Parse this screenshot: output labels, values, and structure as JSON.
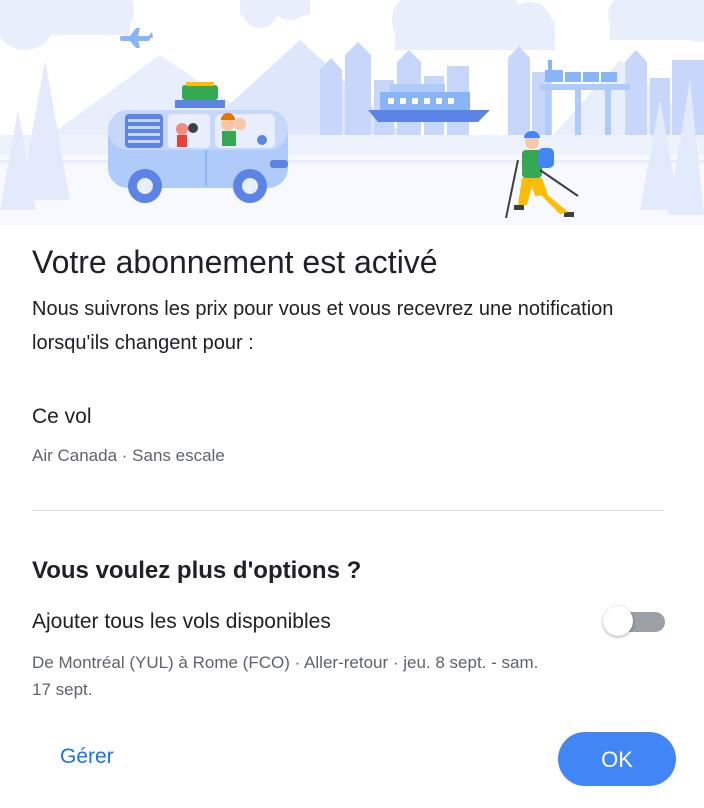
{
  "dialog": {
    "title": "Votre abonnement est activé",
    "description": "Nous suivrons les prix pour vous et vous recevrez une notification lorsqu'ils changent pour :",
    "item": {
      "title": "Ce vol",
      "subtitle": "Air Canada · Sans escale"
    },
    "more_options": {
      "title": "Vous voulez plus d'options ?",
      "add_all_label": "Ajouter tous les vols disponibles",
      "add_all_details": "De Montréal (YUL) à Rome (FCO) · Aller-retour · jeu. 8 sept. - sam. 17 sept.",
      "toggle_on": false
    },
    "buttons": {
      "manage": "Gérer",
      "ok": "OK"
    }
  },
  "colors": {
    "accent": "#1a73e8",
    "ok_button": "#4285f4",
    "illustration_light": "#e8eefc",
    "illustration_mid": "#aecbfa",
    "illustration_dark": "#5c84e6"
  },
  "icons": {
    "toggle": "switch-icon",
    "illustration": "travel-illustration"
  }
}
